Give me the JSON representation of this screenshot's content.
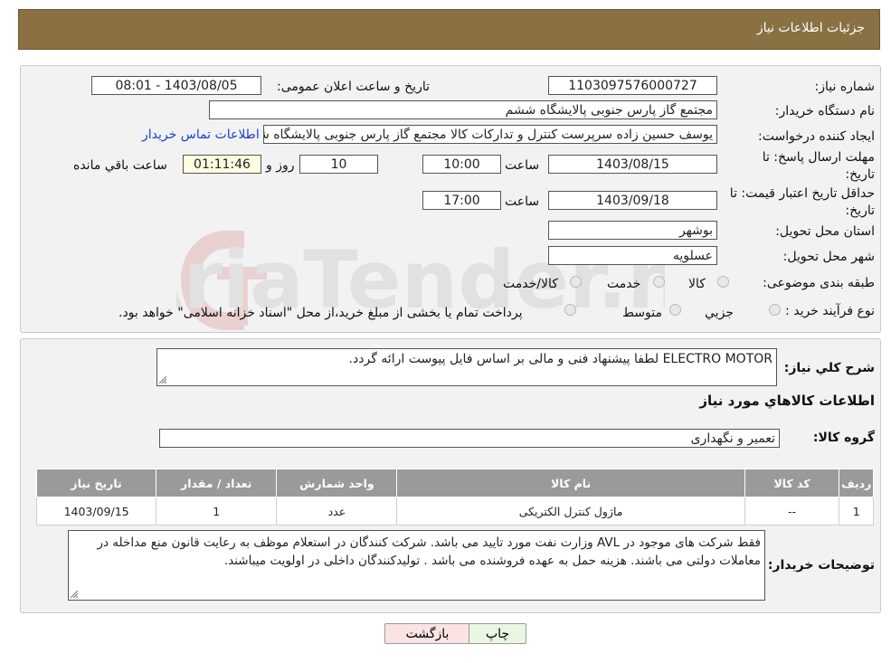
{
  "header": {
    "title": "جزئیات اطلاعات نیاز"
  },
  "form": {
    "need_number_label": "شماره نیاز:",
    "need_number": "1103097576000727",
    "announce_label": "تاریخ و ساعت اعلان عمومی:",
    "announce_value": "1403/08/05 - 08:01",
    "buyer_org_label": "نام دستگاه خریدار:",
    "buyer_org": "مجتمع گاز پارس جنوبی  پالایشگاه ششم",
    "creator_label": "ایجاد کننده درخواست:",
    "creator": "یوسف حسین زاده سرپرست کنترل و تدارکات کالا مجتمع گاز پارس جنوبی  پالایشگاه ششم",
    "contact_link": "اطلاعات تماس خریدار",
    "deadline_label_1": "مهلت ارسال پاسخ: تا",
    "deadline_label_2": "تاریخ:",
    "deadline_date": "1403/08/15",
    "time_label": "ساعت",
    "deadline_time": "10:00",
    "days_value": "10",
    "days_label": "روز و",
    "remaining_time": "01:11:46",
    "remaining_label": "ساعت باقي مانده",
    "validity_label_1": "حداقل تاریخ اعتبار قیمت: تا",
    "validity_label_2": "تاریخ:",
    "validity_date": "1403/09/18",
    "validity_time_label": "ساعت",
    "validity_time": "17:00",
    "province_label": "استان محل تحویل:",
    "province": "بوشهر",
    "city_label": "شهر محل تحویل:",
    "city": "عسلویه",
    "category_label": "طبقه بندی موضوعی:",
    "category_options": [
      "کالا",
      "خدمت",
      "کالا/خدمت"
    ],
    "purchase_type_label": "نوع فرآیند خرید :",
    "purchase_options": [
      "جزيي",
      "متوسط"
    ],
    "purchase_note": "پرداخت تمام یا بخشی از مبلغ خرید،از محل \"اسناد خزانه اسلامی\" خواهد بود."
  },
  "details": {
    "description_label": "شرح كلي نياز:",
    "description": "ELECTRO MOTOR لطفا پیشنهاد فنی و مالی بر اساس فایل پیوست ارائه گردد.",
    "items_title": "اطلاعات كالاهاي مورد نياز",
    "group_label": "گروه كالا:",
    "group_value": "تعمیر و نگهداری",
    "table": {
      "headers": [
        "رديف",
        "کد کالا",
        "نام کالا",
        "واحد شمارش",
        "تعداد / مقدار",
        "تاریخ نیاز"
      ],
      "rows": [
        [
          "1",
          "--",
          "ماژول کنترل الکتریکی",
          "عدد",
          "1",
          "1403/09/15"
        ]
      ]
    },
    "buyer_notes_label": "توضیحات خریدار:",
    "buyer_notes": "فقط شرکت های موجود در AVL وزارت نفت مورد تایید می باشد. شرکت کنندگان در استعلام موظف به رعایت قانون منع مداخله در معاملات دولتی می باشند. هزینه حمل به عهده فروشنده می باشد . تولیدکنندگان داخلی در اولویت میباشند."
  },
  "buttons": {
    "print": "چاپ",
    "back": "بازگشت"
  },
  "watermark": "AriaTender.neT",
  "colors": {
    "header_bg": "#8a7143",
    "link": "#1a3fd0",
    "back_button": "#fbe3e3",
    "print_button": "#e8f6e2"
  }
}
